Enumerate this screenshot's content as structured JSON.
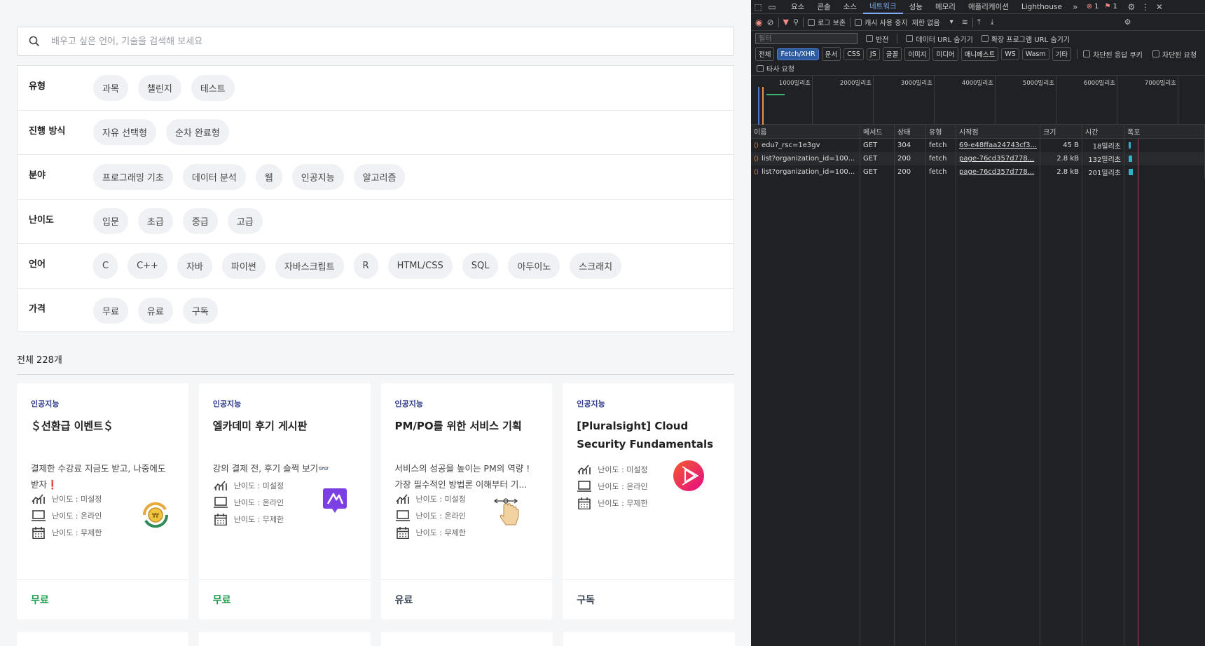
{
  "search": {
    "placeholder": "배우고 싶은 언어, 기술을 검색해 보세요"
  },
  "filters": [
    {
      "label": "유형",
      "chips": [
        "과목",
        "챌린지",
        "테스트"
      ]
    },
    {
      "label": "진행 방식",
      "chips": [
        "자유 선택형",
        "순차 완료형"
      ]
    },
    {
      "label": "분야",
      "chips": [
        "프로그래밍 기초",
        "데이터 분석",
        "웹",
        "인공지능",
        "알고리즘"
      ]
    },
    {
      "label": "난이도",
      "chips": [
        "입문",
        "초급",
        "중급",
        "고급"
      ]
    },
    {
      "label": "언어",
      "chips": [
        "C",
        "C++",
        "자바",
        "파이썬",
        "자바스크립트",
        "R",
        "HTML/CSS",
        "SQL",
        "아두이노",
        "스크래치"
      ]
    },
    {
      "label": "가격",
      "chips": [
        "무료",
        "유료",
        "구독"
      ]
    }
  ],
  "total": "전체 228개",
  "cards": [
    {
      "category": "인공지능",
      "title": "＄선환급 이벤트＄",
      "desc": "결제한 수강료 지금도 받고, 나중에도 받자❗",
      "meta": [
        "난이도 : 미설정",
        "난이도 : 온라인",
        "난이도 : 무제한"
      ],
      "price": "무료",
      "logo": "refund-coin-logo"
    },
    {
      "category": "인공지능",
      "title": "엘카데미 후기 게시판",
      "desc": "강의 결제 전, 후기 슬쩍 보기👓",
      "meta": [
        "난이도 : 미설정",
        "난이도 : 온라인",
        "난이도 : 무제한"
      ],
      "price": "무료",
      "logo": "elice-logo"
    },
    {
      "category": "인공지능",
      "title": "PM/PO를 위한 서비스 기획",
      "desc": "서비스의 성공을 높이는 PM의 역량 ! 가장 필수적인 방법론 이해부터 기...",
      "meta": [
        "난이도 : 미설정",
        "난이도 : 온라인",
        "난이도 : 무제한"
      ],
      "price": "유료",
      "logo": "hand-drag-logo"
    },
    {
      "category": "인공지능",
      "title": "[Pluralsight] Cloud Security Fundamentals",
      "desc": "",
      "meta": [
        "난이도 : 미설정",
        "난이도 : 온라인",
        "난이도 : 무제한"
      ],
      "price": "구독",
      "logo": "pluralsight-logo"
    }
  ],
  "devtools": {
    "tabs": [
      "요소",
      "콘솔",
      "소스",
      "네트워크",
      "성능",
      "메모리",
      "애플리케이션",
      "Lighthouse"
    ],
    "active_tab": "네트워크",
    "error_count": "1",
    "warning_count": "1",
    "toolbar": {
      "preserve_log": "로그 보존",
      "disable_cache": "캐시 사용 중지",
      "throttle": "제한 없음"
    },
    "filter": {
      "placeholder": "필터",
      "invert": "반전",
      "hide_data_urls": "데이터 URL 숨기기",
      "hide_ext_urls": "확장 프로그램 URL 숨기기"
    },
    "types": [
      "전체",
      "Fetch/XHR",
      "문서",
      "CSS",
      "JS",
      "글꼴",
      "이미지",
      "미디어",
      "매니페스트",
      "WS",
      "Wasm",
      "기타"
    ],
    "active_type": "Fetch/XHR",
    "blocked_cookies": "차단된 응답 쿠키",
    "blocked_requests": "차단된 요청",
    "third_party": "타사 요청",
    "ticks": [
      "1000밀리초",
      "2000밀리초",
      "3000밀리초",
      "4000밀리초",
      "5000밀리초",
      "6000밀리초",
      "7000밀리초"
    ],
    "columns": [
      "이름",
      "메서드",
      "상태",
      "유형",
      "시작점",
      "크기",
      "시간",
      "폭포"
    ],
    "rows": [
      {
        "name": "edu?_rsc=1e3gv",
        "method": "GET",
        "status": "304",
        "type": "fetch",
        "initiator": "69-e48ffaa24743cf3...",
        "size": "45 B",
        "time": "18밀리초"
      },
      {
        "name": "list?organization_id=100...",
        "method": "GET",
        "status": "200",
        "type": "fetch",
        "initiator": "page-76cd357d778...",
        "size": "2.8 kB",
        "time": "132밀리초"
      },
      {
        "name": "list?organization_id=100...",
        "method": "GET",
        "status": "200",
        "type": "fetch",
        "initiator": "page-76cd357d778...",
        "size": "2.8 kB",
        "time": "201밀리초"
      }
    ]
  }
}
